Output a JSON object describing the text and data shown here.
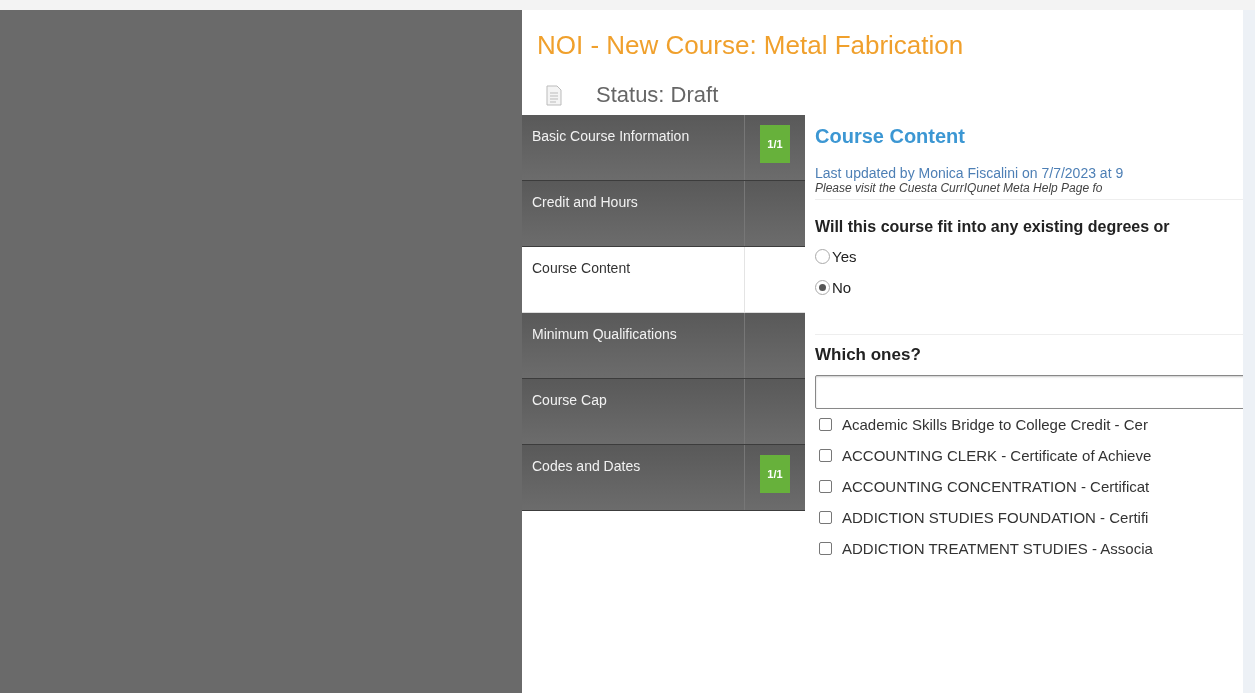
{
  "header": {
    "title": "NOI - New Course: Metal Fabrication",
    "status": "Status: Draft"
  },
  "sidebar": {
    "items": [
      {
        "label": "Basic Course Information",
        "badge": "1/1",
        "selected": false
      },
      {
        "label": "Credit and Hours",
        "selected": false
      },
      {
        "label": "Course Content",
        "selected": true
      },
      {
        "label": "Minimum Qualifications",
        "selected": false
      },
      {
        "label": "Course Cap",
        "selected": false
      },
      {
        "label": "Codes and Dates",
        "badge": "1/1",
        "selected": false
      }
    ]
  },
  "content": {
    "heading": "Course Content",
    "last_updated": "Last updated by Monica Fiscalini on 7/7/2023 at 9",
    "help_note": "Please visit the Cuesta CurrIQunet Meta Help Page fo",
    "question": "Will this course fit into any existing degrees or",
    "options": [
      {
        "label": "Yes",
        "selected": false
      },
      {
        "label": "No",
        "selected": true
      }
    ],
    "list_heading": "Which ones?",
    "programs": [
      {
        "label": "Academic Skills Bridge to College Credit - Cer",
        "checked": false
      },
      {
        "label": "ACCOUNTING CLERK - Certificate of Achieve",
        "checked": false
      },
      {
        "label": "ACCOUNTING CONCENTRATION - Certificat",
        "checked": false
      },
      {
        "label": "ADDICTION STUDIES FOUNDATION - Certifi",
        "checked": false
      },
      {
        "label": "ADDICTION TREATMENT STUDIES - Associa",
        "checked": false
      }
    ]
  }
}
